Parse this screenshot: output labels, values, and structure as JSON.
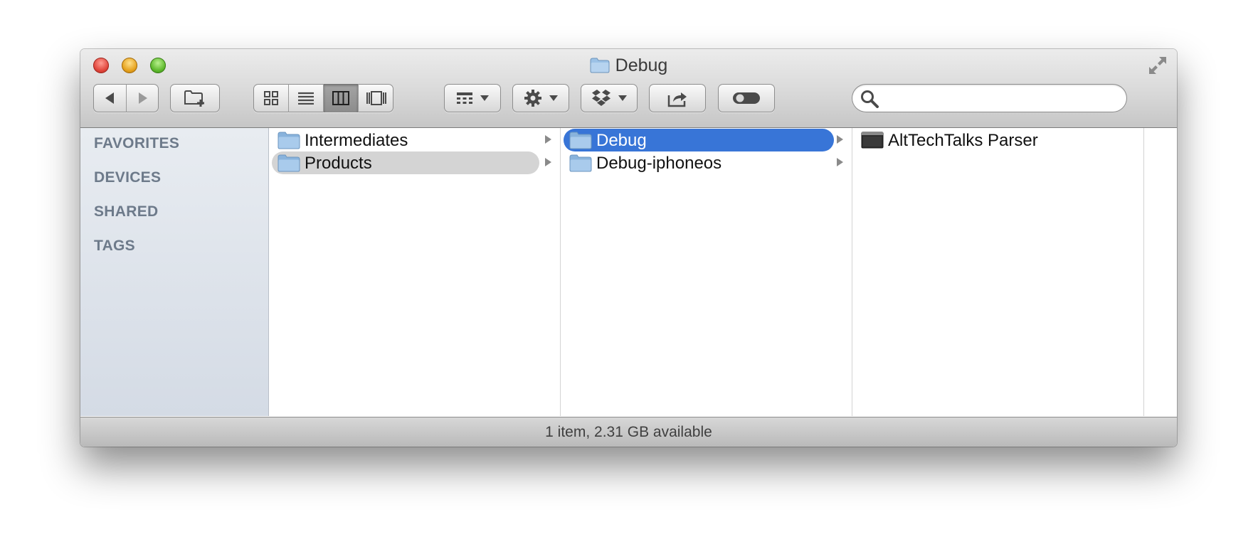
{
  "window": {
    "title": "Debug"
  },
  "toolbar": {
    "back_icon": "back-arrow-icon",
    "forward_icon": "forward-arrow-icon",
    "new_folder_icon": "new-folder-icon",
    "view_modes": [
      "icon-view-icon",
      "list-view-icon",
      "column-view-icon",
      "cover-flow-icon"
    ],
    "active_view": "column-view-icon",
    "arrange_icon": "arrange-icon",
    "action_icon": "gear-icon",
    "dropbox_icon": "dropbox-icon",
    "share_icon": "share-icon",
    "tags_icon": "tags-toggle-icon"
  },
  "search": {
    "placeholder": "",
    "value": ""
  },
  "sidebar": {
    "headings": [
      "FAVORITES",
      "DEVICES",
      "SHARED",
      "TAGS"
    ]
  },
  "columns": [
    {
      "items": [
        {
          "label": "Intermediates",
          "kind": "folder",
          "has_children": true,
          "state": "none"
        },
        {
          "label": "Products",
          "kind": "folder",
          "has_children": true,
          "state": "inactive-selected"
        }
      ]
    },
    {
      "items": [
        {
          "label": "Debug",
          "kind": "folder",
          "has_children": true,
          "state": "selected"
        },
        {
          "label": "Debug-iphoneos",
          "kind": "folder",
          "has_children": true,
          "state": "none"
        }
      ]
    },
    {
      "items": [
        {
          "label": "AltTechTalks Parser",
          "kind": "executable",
          "has_children": false,
          "state": "none"
        }
      ]
    }
  ],
  "status": {
    "text": "1 item, 2.31 GB available"
  },
  "colors": {
    "selection": "#3875d7",
    "inactive_selection": "#d4d4d4",
    "sidebar_heading": "#6d7a8a",
    "folder": "#8fb8e0"
  }
}
